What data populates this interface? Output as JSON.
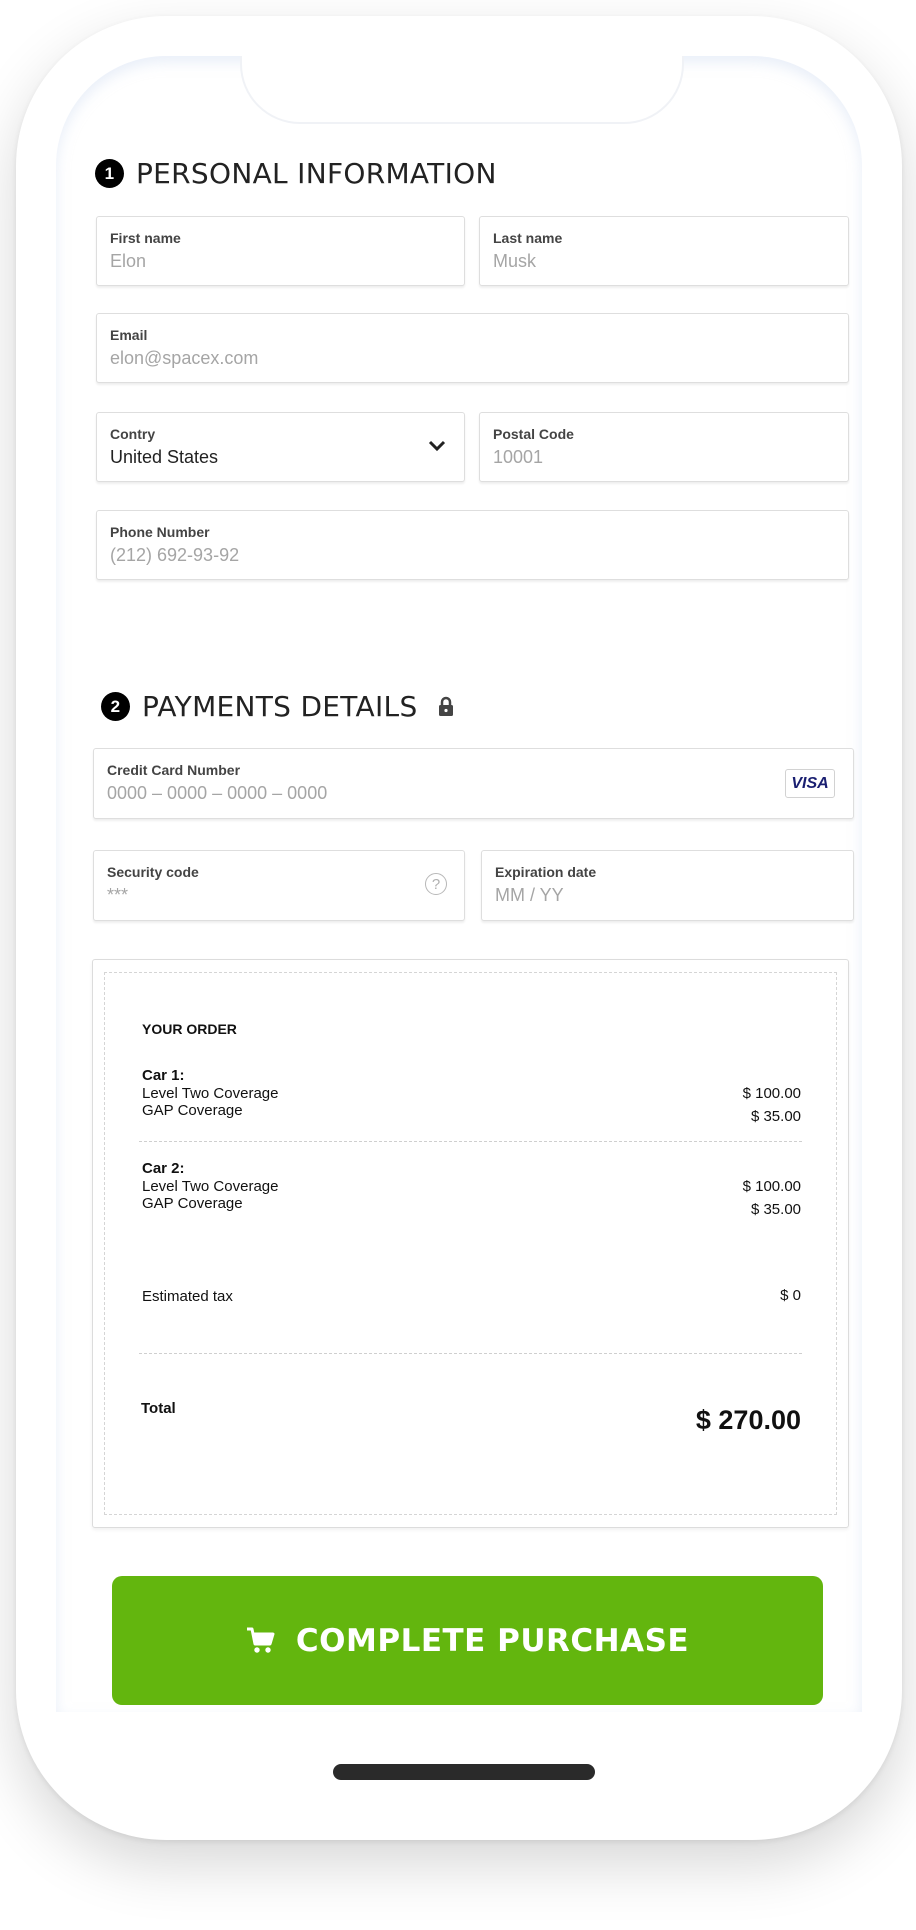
{
  "personal": {
    "step": "1",
    "title": "PERSONAL INFORMATION",
    "first_name": {
      "label": "First name",
      "value": "Elon"
    },
    "last_name": {
      "label": "Last name",
      "value": "Musk"
    },
    "email": {
      "label": "Email",
      "value": "elon@spacex.com"
    },
    "country": {
      "label": "Contry",
      "value": "United States"
    },
    "postal": {
      "label": "Postal Code",
      "value": "10001"
    },
    "phone": {
      "label": "Phone Number",
      "value": "(212) 692-93-92"
    }
  },
  "payment": {
    "step": "2",
    "title": "PAYMENTS DETAILS",
    "card": {
      "label": "Credit Card Number",
      "value": "0000 – 0000 – 0000 – 0000",
      "brand": "VISA"
    },
    "security": {
      "label": "Security code",
      "value": "***",
      "help": "?"
    },
    "expiration": {
      "label": "Expiration date",
      "value": "MM / YY"
    }
  },
  "order": {
    "title": "YOUR ORDER",
    "car1": {
      "name": "Car 1:",
      "item1": "Level Two Coverage",
      "item2": "GAP Coverage",
      "price1": "$ 100.00",
      "price2": "$ 35.00"
    },
    "car2": {
      "name": "Car 2:",
      "item1": "Level Two Coverage",
      "item2": "GAP Coverage",
      "price1": "$ 100.00",
      "price2": "$ 35.00"
    },
    "tax_label": "Estimated tax",
    "tax_value": "$ 0",
    "total_label": "Total",
    "total_value": "$ 270.00"
  },
  "cta": {
    "label": "COMPLETE PURCHASE"
  },
  "colors": {
    "accent": "#63b60e",
    "visa": "#1a1f71"
  }
}
